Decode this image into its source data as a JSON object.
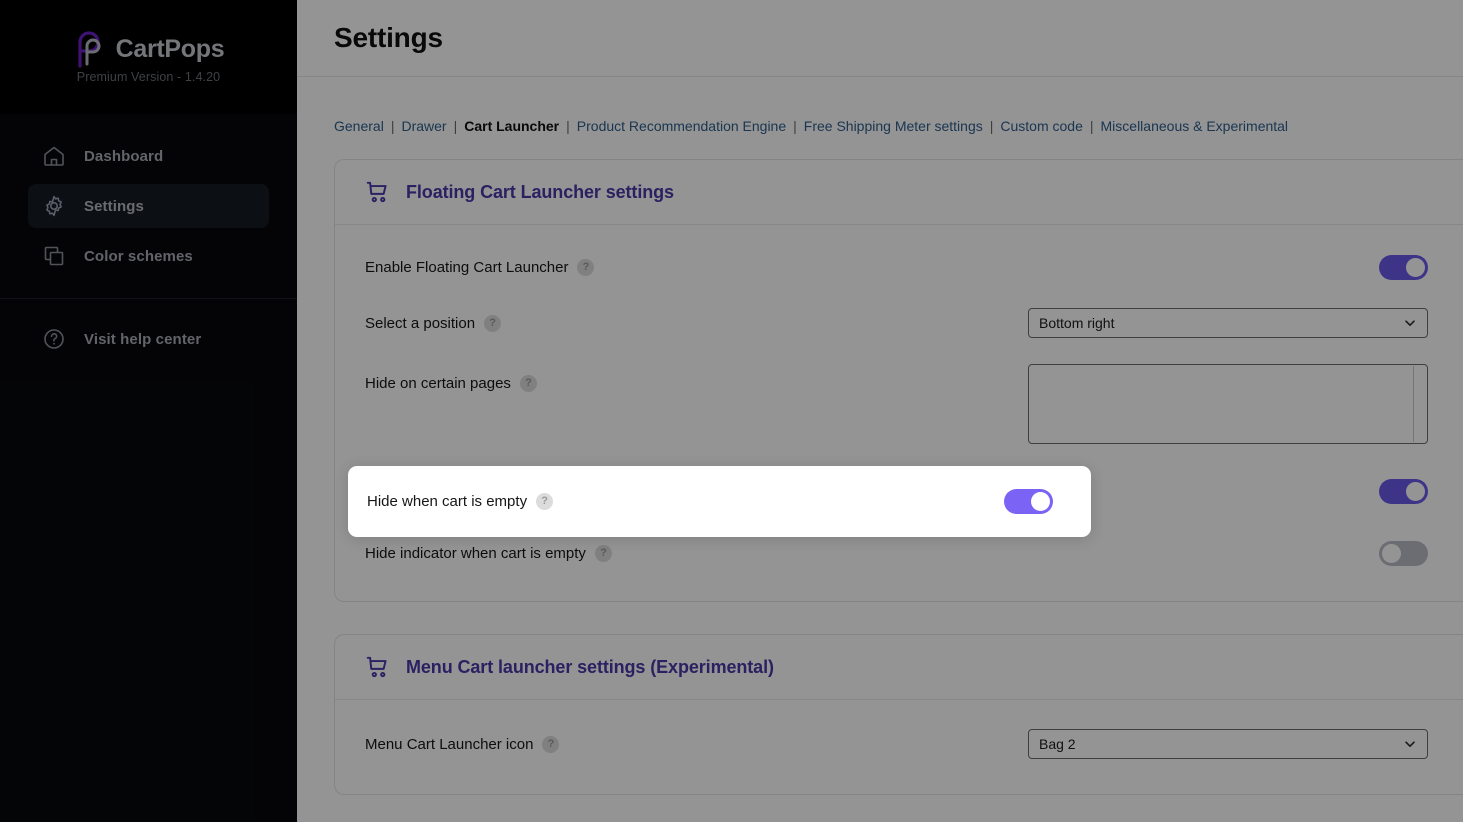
{
  "sidebar": {
    "brand": {
      "name": "CartPops",
      "version": "Premium Version - 1.4.20",
      "logo_icon": "cartpops-p-logo"
    },
    "items": [
      {
        "label": "Dashboard",
        "icon": "home-icon",
        "active": false
      },
      {
        "label": "Settings",
        "icon": "gear-icon",
        "active": true
      },
      {
        "label": "Color schemes",
        "icon": "layers-icon",
        "active": false
      }
    ],
    "bottom": {
      "label": "Visit help center",
      "icon": "question-circle-icon"
    }
  },
  "header": {
    "title": "Settings"
  },
  "tabs": [
    {
      "label": "General",
      "current": false
    },
    {
      "label": "Drawer",
      "current": false
    },
    {
      "label": "Cart Launcher",
      "current": true
    },
    {
      "label": "Product Recommendation Engine",
      "current": false
    },
    {
      "label": "Free Shipping Meter settings",
      "current": false
    },
    {
      "label": "Custom code",
      "current": false
    },
    {
      "label": "Miscellaneous & Experimental",
      "current": false
    }
  ],
  "tab_separator": "|",
  "cards": [
    {
      "title": "Floating Cart Launcher settings",
      "icon": "shopping-cart-icon",
      "rows": [
        {
          "label": "Enable Floating Cart Launcher",
          "help": "?",
          "control": "toggle",
          "value": "on"
        },
        {
          "label": "Select a position",
          "help": "?",
          "control": "select",
          "value": "Bottom right"
        },
        {
          "label": "Hide on certain pages",
          "help": "?",
          "control": "textarea",
          "value": ""
        },
        {
          "label": "Hide when cart is empty",
          "help": "?",
          "control": "toggle",
          "value": "on"
        },
        {
          "label": "Hide indicator when cart is empty",
          "help": "?",
          "control": "toggle",
          "value": "off"
        }
      ]
    },
    {
      "title": "Menu Cart launcher settings (Experimental)",
      "icon": "shopping-cart-icon",
      "rows": [
        {
          "label": "Menu Cart Launcher icon",
          "help": "?",
          "control": "select",
          "value": "Bag 2"
        }
      ]
    }
  ],
  "spotlight": {
    "label": "Hide when cart is empty",
    "help": "?",
    "toggle_state": "on"
  },
  "colors": {
    "brand_purple": "#4a38a8",
    "toggle_on": "#6a5bea",
    "toggle_off": "#b8bcc4",
    "link_blue": "#2f5d8c",
    "sidebar_bg": "#07080c"
  }
}
